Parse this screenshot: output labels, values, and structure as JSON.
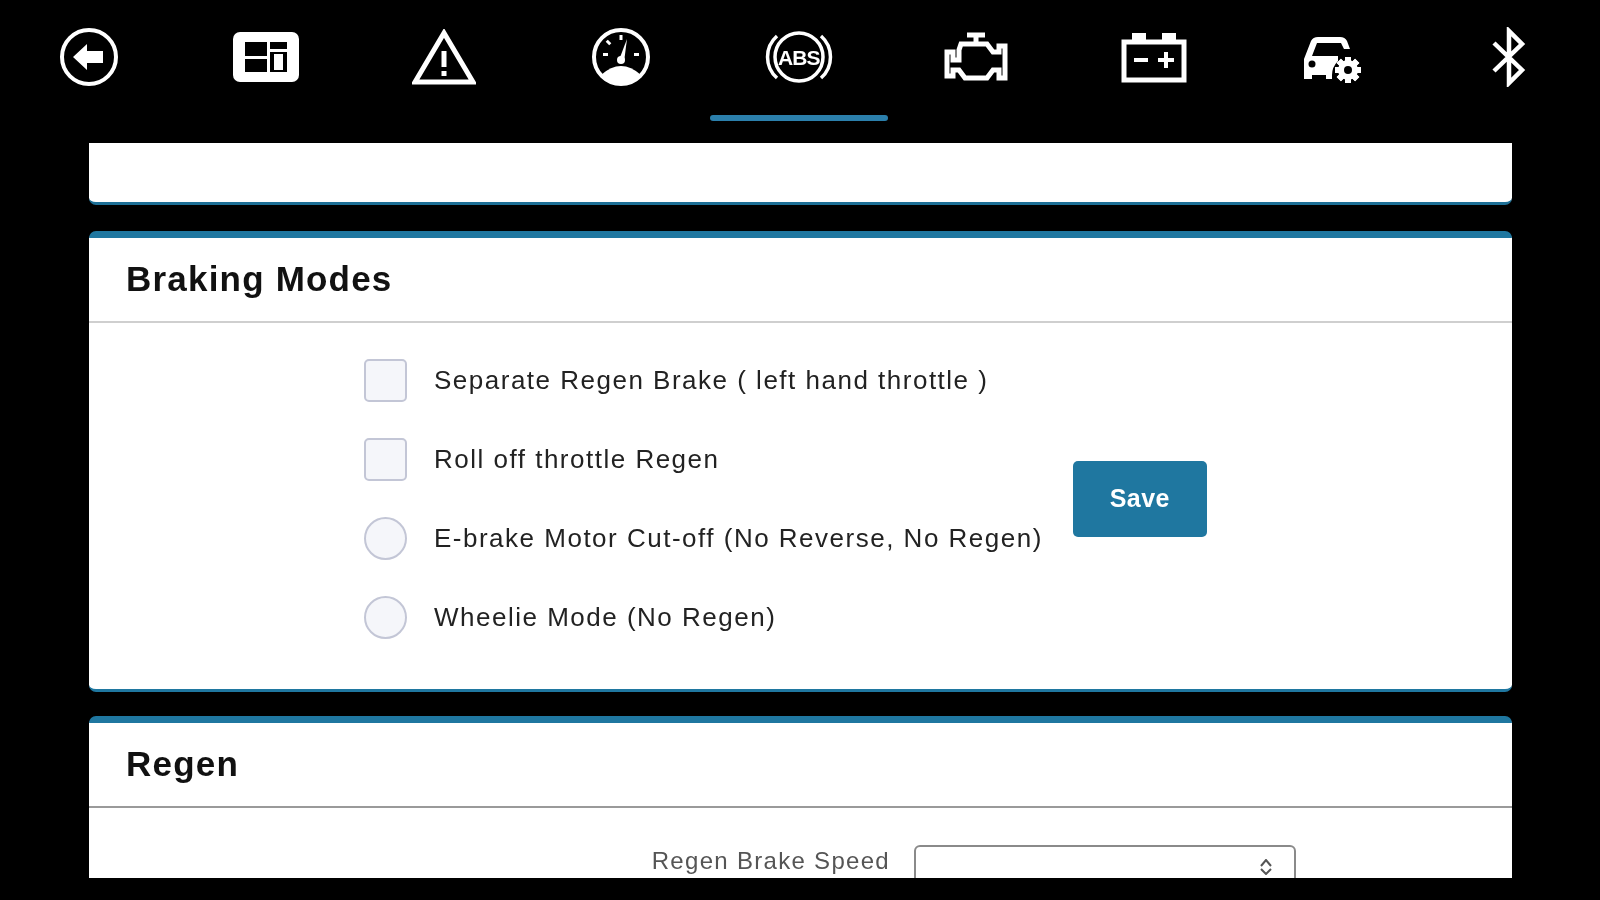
{
  "nav": {
    "tabs": [
      {
        "selected": false
      },
      {
        "selected": false
      },
      {
        "selected": false
      },
      {
        "label": "ABS",
        "selected": true
      },
      {
        "selected": false
      },
      {
        "selected": false
      },
      {
        "selected": false
      },
      {
        "selected": false
      }
    ]
  },
  "braking_modes": {
    "title": "Braking Modes",
    "options": [
      {
        "kind": "checkbox",
        "label": "Separate Regen Brake ( left hand throttle )",
        "checked": false
      },
      {
        "kind": "checkbox",
        "label": "Roll off throttle Regen",
        "checked": false
      },
      {
        "kind": "radio",
        "label": "E-brake Motor Cut-off (No Reverse, No Regen)",
        "selected": false
      },
      {
        "kind": "radio",
        "label": "Wheelie Mode (No Regen)",
        "selected": false
      }
    ],
    "save_button": "Save"
  },
  "regen": {
    "title": "Regen",
    "fields": [
      {
        "label": "Regen Brake Speed"
      }
    ]
  }
}
